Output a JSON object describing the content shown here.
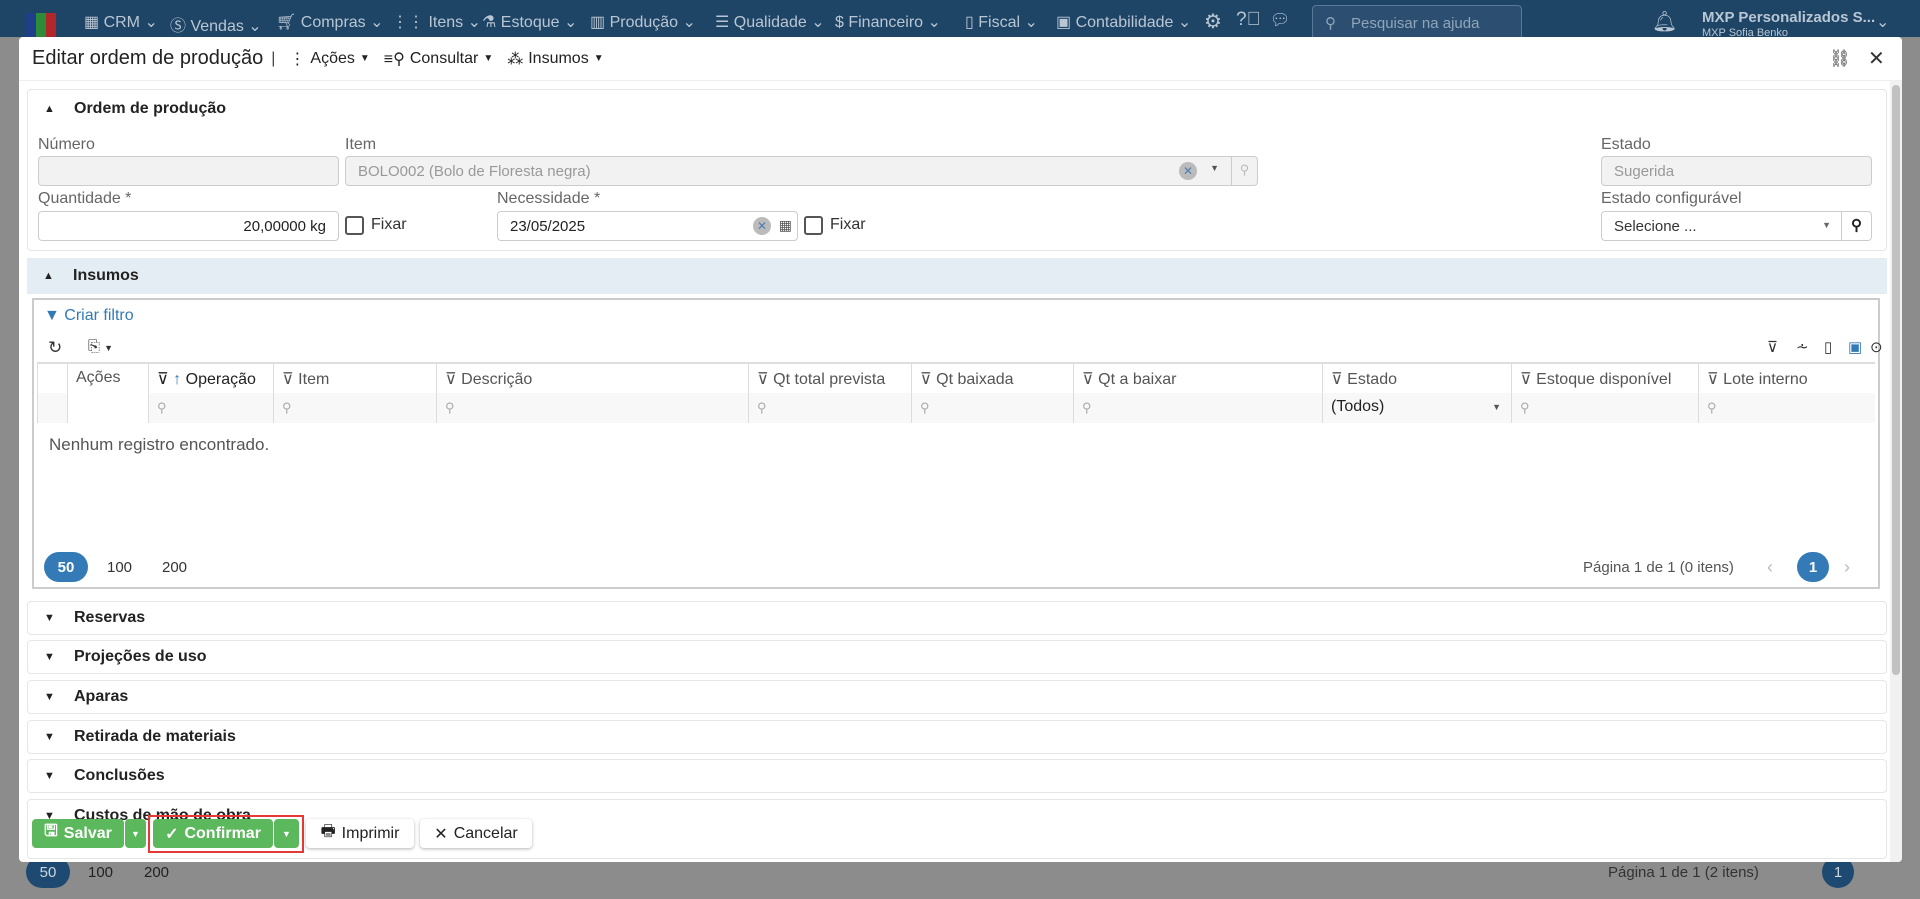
{
  "topnav": {
    "items": [
      "CRM",
      "Vendas",
      "Compras",
      "Itens",
      "Estoque",
      "Produção",
      "Qualidade",
      "Financeiro",
      "Fiscal",
      "Contabilidade"
    ],
    "search_placeholder": "Pesquisar na ajuda",
    "company": "MXP Personalizados S...",
    "user": "MXP Sofia Benko",
    "brand_color": "#1e4466"
  },
  "modal": {
    "title": "Editar ordem de produção",
    "menus": [
      "Ações",
      "Consultar",
      "Insumos"
    ]
  },
  "ordem": {
    "title": "Ordem de produção",
    "numero_label": "Número",
    "numero_value": "",
    "item_label": "Item",
    "item_value": "BOLO002 (Bolo de Floresta negra)",
    "estado_label": "Estado",
    "estado_value": "Sugerida",
    "quantidade_label": "Quantidade *",
    "quantidade_value": "20,00000 kg",
    "fixar_label": "Fixar",
    "necessidade_label": "Necessidade *",
    "necessidade_value": "23/05/2025",
    "estado_conf_label": "Estado configurável",
    "estado_conf_placeholder": "Selecione ..."
  },
  "insumos": {
    "title": "Insumos",
    "criar_filtro": "Criar filtro",
    "columns": [
      "Ações",
      "Operação",
      "Item",
      "Descrição",
      "Qt total prevista",
      "Qt baixada",
      "Qt a baixar",
      "Estado",
      "Estoque disponível",
      "Lote interno"
    ],
    "estado_filter": "(Todos)",
    "empty": "Nenhum registro encontrado.",
    "page_sizes": [
      "50",
      "100",
      "200"
    ],
    "page_info": "Página 1 de 1 (0 itens)",
    "current_page": "1"
  },
  "sections": [
    "Reservas",
    "Projeções de uso",
    "Aparas",
    "Retirada de materiais",
    "Conclusões",
    "Custos de mão de obra"
  ],
  "footer": {
    "salvar": "Salvar",
    "confirmar": "Confirmar",
    "imprimir": "Imprimir",
    "cancelar": "Cancelar"
  },
  "background": {
    "page_sizes": [
      "50",
      "100",
      "200"
    ],
    "page_info": "Página 1 de 1 (2 itens)",
    "current_page": "1"
  },
  "colors": {
    "primary": "#337ab7",
    "success": "#5cb85c",
    "highlight": "#e53935"
  }
}
